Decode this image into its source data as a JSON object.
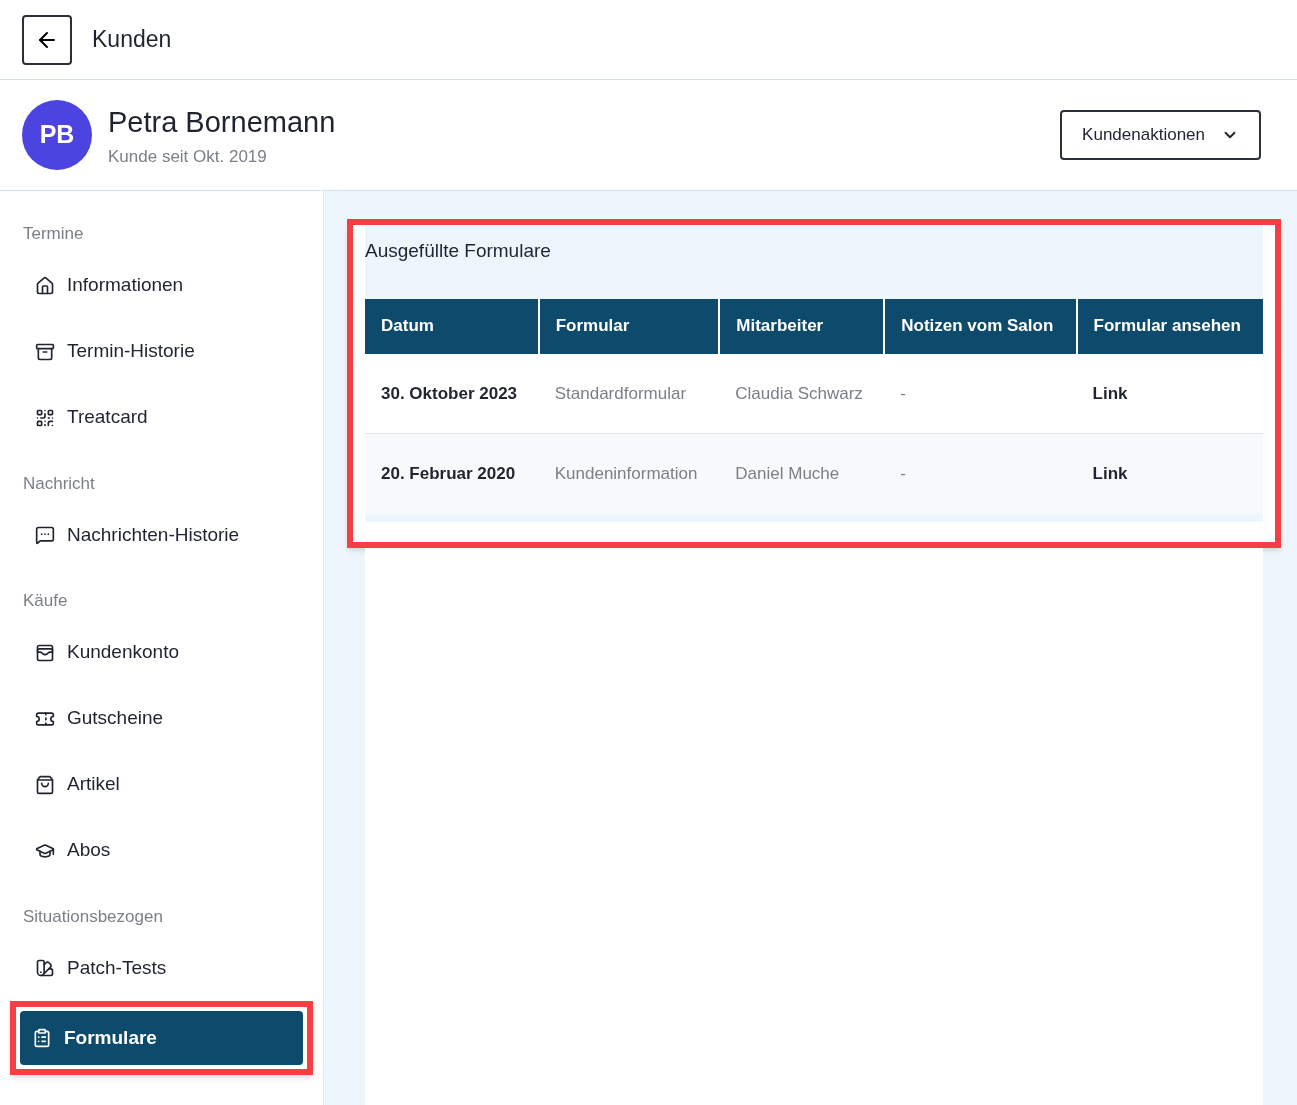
{
  "header": {
    "title": "Kunden"
  },
  "customer": {
    "initials": "PB",
    "name": "Petra Bornemann",
    "since": "Kunde seit Okt. 2019",
    "actions_button": "Kundenaktionen"
  },
  "sidebar": {
    "sections": [
      {
        "title": "Termine",
        "items": [
          {
            "label": "Informationen",
            "selected": false
          },
          {
            "label": "Termin-Historie",
            "selected": false
          },
          {
            "label": "Treatcard",
            "selected": false
          }
        ]
      },
      {
        "title": "Nachricht",
        "items": [
          {
            "label": "Nachrichten-Historie",
            "selected": false
          }
        ]
      },
      {
        "title": "Käufe",
        "items": [
          {
            "label": "Kundenkonto",
            "selected": false
          },
          {
            "label": "Gutscheine",
            "selected": false
          },
          {
            "label": "Artikel",
            "selected": false
          },
          {
            "label": "Abos",
            "selected": false
          }
        ]
      },
      {
        "title": "Situationsbezogen",
        "items": [
          {
            "label": "Patch-Tests",
            "selected": false
          },
          {
            "label": "Formulare",
            "selected": true,
            "highlighted": true
          }
        ]
      }
    ]
  },
  "forms": {
    "title": "Ausgefüllte Formulare",
    "highlighted": true,
    "table": {
      "columns": [
        "Datum",
        "Formular",
        "Mitarbeiter",
        "Notizen vom Salon",
        "Formular ansehen"
      ],
      "rows": [
        {
          "datum": "30. Oktober 2023",
          "formular": "Standardformular",
          "mitarbeiter": "Claudia Schwarz",
          "notizen": "-",
          "link": "Link"
        },
        {
          "datum": "20. Februar 2020",
          "formular": "Kundeninformation",
          "mitarbeiter": "Daniel Muche",
          "notizen": "-",
          "link": "Link"
        }
      ]
    }
  }
}
